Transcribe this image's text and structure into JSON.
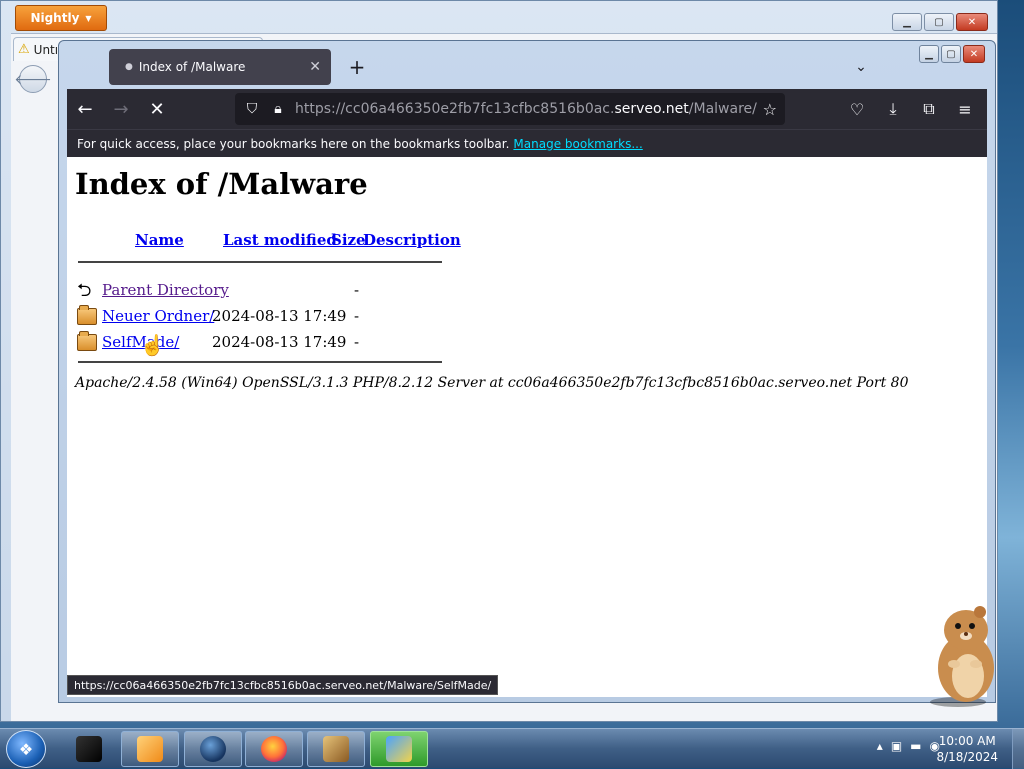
{
  "background_window": {
    "app_button": "Nightly",
    "tab_title": "Untı"
  },
  "browser": {
    "tab_title": "Index of /Malware",
    "url_prefix": "https://cc06a466350e2fb7fc13cfbc8516b0ac.",
    "url_domain": "serveo.net",
    "url_path": "/Malware/",
    "bookmarks_message": "For quick access, place your bookmarks here on the bookmarks toolbar.",
    "bookmarks_link": "Manage bookmarks...",
    "status_url": "https://cc06a466350e2fb7fc13cfbc8516b0ac.serveo.net/Malware/SelfMade/"
  },
  "page": {
    "heading": "Index of /Malware",
    "columns": {
      "name": "Name",
      "last_modified": "Last modified",
      "size": "Size",
      "description": "Description"
    },
    "rows": [
      {
        "name": "Parent Directory",
        "modified": "",
        "size": "-",
        "type": "parent"
      },
      {
        "name": "Neuer Ordner/",
        "modified": "2024-08-13 17:49",
        "size": "-",
        "type": "folder"
      },
      {
        "name": "SelfMade/",
        "modified": "2024-08-13 17:49",
        "size": "-",
        "type": "folder"
      }
    ],
    "server_signature": "Apache/2.4.58 (Win64) OpenSSL/3.1.3 PHP/8.2.12 Server at cc06a466350e2fb7fc13cfbc8516b0ac.serveo.net Port 80"
  },
  "taskbar": {
    "clock_time": "10:00 AM",
    "clock_date": "8/18/2024"
  },
  "colors": {
    "link": "#0000ee",
    "visited_link": "#551a8b",
    "toolbar_dark": "#2b2a33",
    "bookmark_link": "#00ddff",
    "nightly_orange": "#e06a10"
  }
}
